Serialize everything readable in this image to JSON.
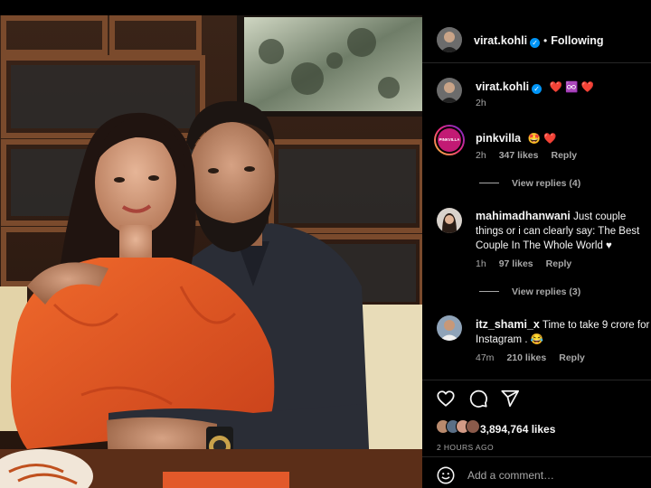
{
  "post": {
    "author": "virat.kohli",
    "following_label": "Following",
    "dot": "•",
    "verified_glyph": "✓"
  },
  "caption": {
    "author": "virat.kohli",
    "emoji": "❤️ ♾️ ❤️",
    "time": "2h"
  },
  "comments": [
    {
      "author": "pinkvilla",
      "text": "🤩 ❤️",
      "time": "2h",
      "likes": "347 likes",
      "reply": "Reply",
      "view_replies": "View replies (4)",
      "avatar_text": "PINKVILLA"
    },
    {
      "author": "mahimadhanwani",
      "text": " Just couple things or i can clearly say: The Best Couple In The Whole World ♥",
      "time": "1h",
      "likes": "97 likes",
      "reply": "Reply",
      "view_replies": "View replies (3)"
    },
    {
      "author": "itz_shami_x",
      "text": " Time to take 9 crore for Instagram . 😂",
      "time": "47m",
      "likes": "210 likes",
      "reply": "Reply"
    }
  ],
  "likes_total": "3,894,764 likes",
  "posted_ago": "2 HOURS AGO",
  "comment_placeholder": "Add a comment…",
  "icons": [
    "heart-icon",
    "comment-icon",
    "share-icon",
    "emoji-icon"
  ],
  "colors": {
    "verified": "#0095f6",
    "heart": "#ff3040",
    "muted": "#a8a8a8",
    "background": "#000000"
  }
}
